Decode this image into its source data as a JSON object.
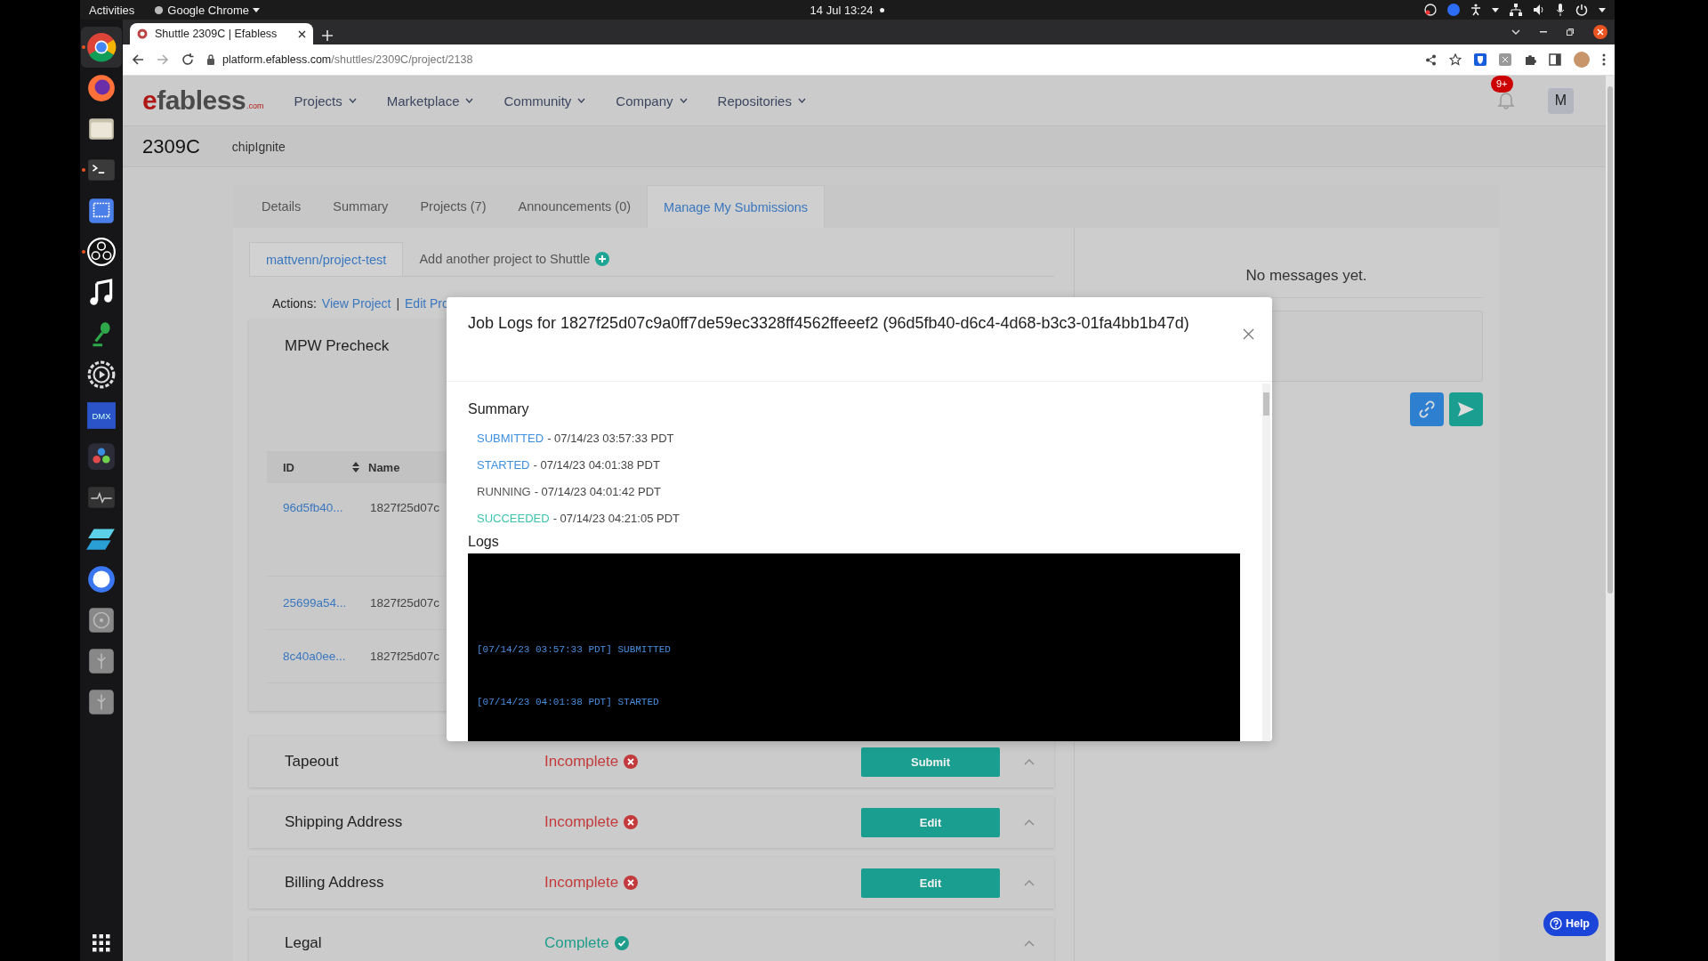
{
  "system_bar": {
    "activities": "Activities",
    "app_menu": "Google Chrome",
    "clock": "14 Jul 13:24"
  },
  "dock": [
    {
      "kind": "chrome",
      "running": true
    },
    {
      "kind": "firefox",
      "running": false
    },
    {
      "kind": "files",
      "running": false
    },
    {
      "kind": "terminal",
      "running": true
    },
    {
      "kind": "screenshot",
      "running": false
    },
    {
      "kind": "obs",
      "running": true
    },
    {
      "kind": "music",
      "running": false
    },
    {
      "kind": "mic",
      "running": false
    },
    {
      "kind": "gear",
      "running": false
    },
    {
      "kind": "dmx",
      "running": false,
      "label": "DMX"
    },
    {
      "kind": "resolve",
      "running": false
    },
    {
      "kind": "monitor",
      "running": false
    },
    {
      "kind": "slant",
      "running": false
    },
    {
      "kind": "ring",
      "running": false
    },
    {
      "kind": "disc",
      "running": false
    },
    {
      "kind": "usb",
      "running": false
    },
    {
      "kind": "usb",
      "running": false
    }
  ],
  "browser": {
    "tab_title": "Shuttle 2309C | Efabless",
    "url_host": "platform.efabless.com",
    "url_path": "/shuttles/2309C/project/2138"
  },
  "site": {
    "logo": "efabless",
    "logo_suffix": ".com",
    "menu": [
      "Projects",
      "Marketplace",
      "Community",
      "Company",
      "Repositories"
    ],
    "notification_badge": "9+",
    "avatar": "M"
  },
  "shuttle": {
    "name": "2309C",
    "program": "chipIgnite"
  },
  "tabs": [
    {
      "label": "Details",
      "selected": false
    },
    {
      "label": "Summary",
      "selected": false
    },
    {
      "label": "Projects (7)",
      "selected": false
    },
    {
      "label": "Announcements (0)",
      "selected": false
    },
    {
      "label": "Manage My Submissions",
      "selected": true
    }
  ],
  "project_tabs": [
    {
      "label": "mattvenn/project-test",
      "selected": true
    },
    {
      "label": "Add another project to Shuttle",
      "selected": false
    }
  ],
  "actions": {
    "label": "Actions:",
    "separator": "|",
    "links": [
      "View Project",
      "Edit Pro"
    ]
  },
  "precheck": {
    "title": "MPW Precheck",
    "columns": [
      "ID",
      "Name"
    ],
    "rows": [
      {
        "id": "96d5fb40...",
        "name": "1827f25d07c"
      },
      {
        "id": "25699a54...",
        "name": "1827f25d07c"
      },
      {
        "id": "8c40a0ee...",
        "name": "1827f25d07c"
      }
    ]
  },
  "sections": [
    {
      "title": "Tapeout",
      "status": "Incomplete",
      "complete": false,
      "button": "Submit"
    },
    {
      "title": "Shipping Address",
      "status": "Incomplete",
      "complete": false,
      "button": "Edit"
    },
    {
      "title": "Billing Address",
      "status": "Incomplete",
      "complete": false,
      "button": "Edit"
    },
    {
      "title": "Legal",
      "status": "Complete",
      "complete": true
    }
  ],
  "messages": {
    "empty_text": "No messages yet."
  },
  "modal": {
    "title": "Job Logs for 1827f25d07c9a0ff7de59ec3328ff4562ffeeef2 (96d5fb40-d6c4-4d68-b3c3-01fa4bb1b47d)",
    "summary_heading": "Summary",
    "summary": [
      {
        "status": "SUBMITTED",
        "color": "#3d8fe0",
        "time": "- 07/14/23 03:57:33 PDT"
      },
      {
        "status": "STARTED",
        "color": "#3d8fe0",
        "time": "- 07/14/23 04:01:38 PDT"
      },
      {
        "status": "RUNNING",
        "color": "#555555",
        "time": "- 07/14/23 04:01:42 PDT"
      },
      {
        "status": "SUCCEEDED",
        "color": "#3cc3b0",
        "time": "- 07/14/23 04:21:05 PDT"
      }
    ],
    "logs_heading": "Logs",
    "log_lines": [
      "[07/14/23 03:57:33 PDT] SUBMITTED",
      "[07/14/23 04:01:38 PDT] STARTED"
    ]
  },
  "help": {
    "label": "Help"
  }
}
